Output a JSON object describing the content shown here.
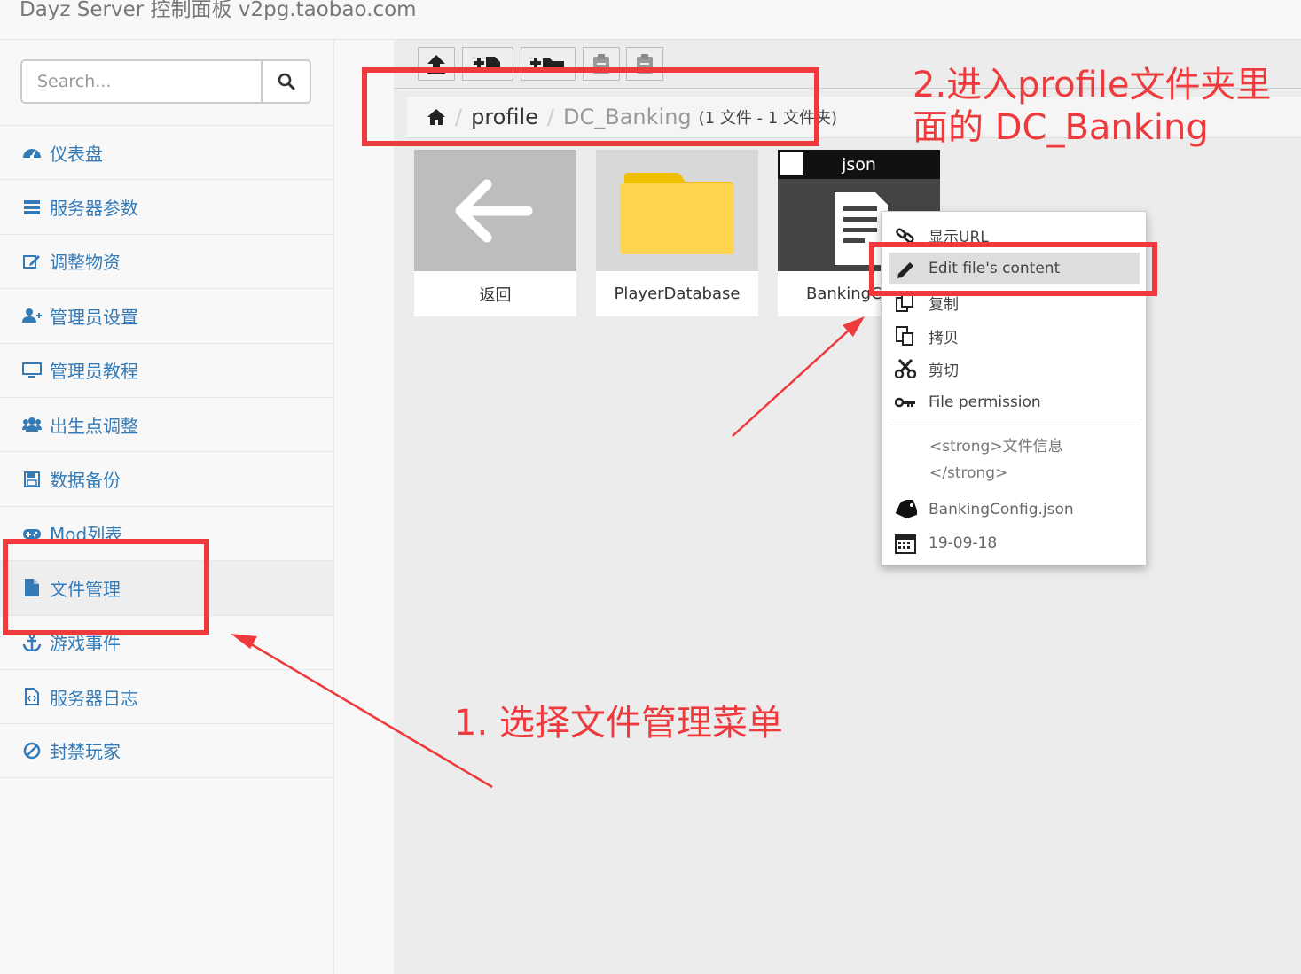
{
  "app": {
    "title": "Dayz Server 控制面板 v2pg.taobao.com"
  },
  "search": {
    "placeholder": "Search..."
  },
  "sidebar": {
    "items": [
      {
        "label": "仪表盘",
        "icon": "dashboard-icon"
      },
      {
        "label": "服务器参数",
        "icon": "server-icon"
      },
      {
        "label": "调整物资",
        "icon": "edit-icon"
      },
      {
        "label": "管理员设置",
        "icon": "user-plus-icon"
      },
      {
        "label": "管理员教程",
        "icon": "monitor-icon"
      },
      {
        "label": "出生点调整",
        "icon": "users-icon"
      },
      {
        "label": "数据备份",
        "icon": "save-icon"
      },
      {
        "label": "Mod列表",
        "icon": "gamepad-icon"
      },
      {
        "label": "文件管理",
        "icon": "file-icon",
        "active": true
      },
      {
        "label": "游戏事件",
        "icon": "anchor-icon"
      },
      {
        "label": "服务器日志",
        "icon": "file-code-icon"
      },
      {
        "label": "封禁玩家",
        "icon": "ban-icon"
      }
    ]
  },
  "breadcrumb": {
    "folder": "profile",
    "current": "DC_Banking",
    "count": "(1 文件 - 1 文件夹)"
  },
  "tiles": [
    {
      "label": "返回",
      "icon": "back-arrow-icon"
    },
    {
      "label": "PlayerDatabase",
      "icon": "folder-icon"
    },
    {
      "label": "BankingConfig.json",
      "badge": "json",
      "icon": "document-icon"
    }
  ],
  "context_menu": {
    "items": [
      {
        "label": "显示URL",
        "icon": "link-icon"
      },
      {
        "label": "Edit file's content",
        "icon": "pencil-icon",
        "highlighted": true
      },
      {
        "label": "复制",
        "icon": "copy-icon"
      },
      {
        "label": "拷贝",
        "icon": "paste-icon"
      },
      {
        "label": "剪切",
        "icon": "scissors-icon"
      },
      {
        "label": "File permission",
        "icon": "key-icon"
      }
    ],
    "info_line1": "<strong>文件信息",
    "info_line2": "</strong>",
    "filename": "BankingConfig.json",
    "date": "19-09-18"
  },
  "annotations": {
    "step1": "1. 选择文件管理菜单",
    "step2_line1": "2.进入profile文件夹里",
    "step2_line2": "面的 DC_Banking"
  },
  "colors": {
    "accent": "#337ab7",
    "annotation": "#ee3a3d"
  }
}
